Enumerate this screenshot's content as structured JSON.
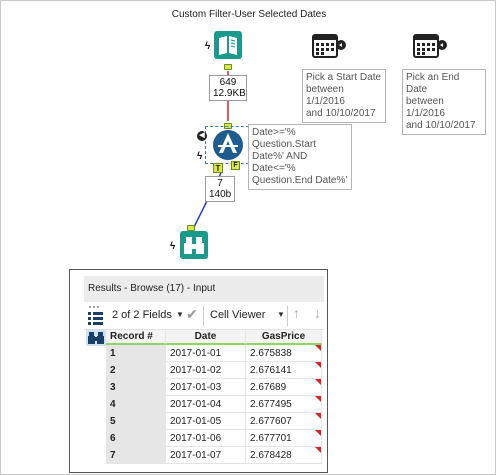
{
  "container": {
    "title": "Custom Filter-User Selected Dates"
  },
  "tools": {
    "input_count": {
      "records": "649",
      "size": "12.9KB"
    },
    "filter_count": {
      "records": "7",
      "size": "140b"
    },
    "filter_anchors": {
      "true_label": "T",
      "false_label": "F"
    },
    "start_date_annotation": "Pick a Start Date\nbetween 1/1/2016\nand 10/10/2017",
    "end_date_annotation": "Pick an End Date\nbetween 1/1/2016\nand 10/10/2017",
    "filter_annotation": "Date>='%\nQuestion.Start\nDate%' AND\nDate<='%\nQuestion.End Date%'"
  },
  "results": {
    "header": "Results - Browse (17) - Input",
    "fields_label": "2 of 2 Fields",
    "viewer_label": "Cell Viewer",
    "columns": [
      "Record #",
      "Date",
      "GasPrice"
    ],
    "rows": [
      [
        "1",
        "2017-01-01",
        "2.675838"
      ],
      [
        "2",
        "2017-01-02",
        "2.676141"
      ],
      [
        "3",
        "2017-01-03",
        "2.67689"
      ],
      [
        "4",
        "2017-01-04",
        "2.677495"
      ],
      [
        "5",
        "2017-01-05",
        "2.677607"
      ],
      [
        "6",
        "2017-01-06",
        "2.677701"
      ],
      [
        "7",
        "2017-01-07",
        "2.678428"
      ]
    ]
  },
  "colors": {
    "tool_teal": "#1a9a8c",
    "filter_blue": "#1d5c8f",
    "wire_red": "#e02020",
    "wire_blue": "#1f3fd0",
    "anchor_green": "#d9e84a",
    "header_underline": "#8fd36b"
  }
}
